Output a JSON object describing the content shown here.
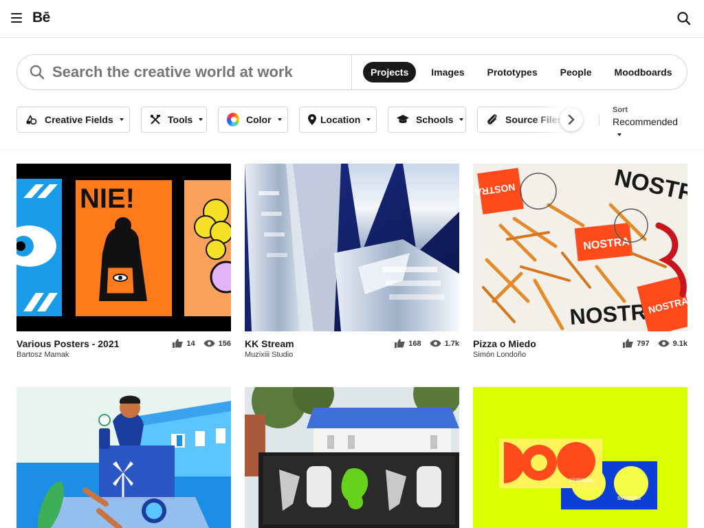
{
  "header": {
    "logo": "Bē"
  },
  "search": {
    "placeholder": "Search the creative world at work",
    "value": ""
  },
  "tabs": [
    {
      "label": "Projects",
      "active": true
    },
    {
      "label": "Images",
      "active": false
    },
    {
      "label": "Prototypes",
      "active": false
    },
    {
      "label": "People",
      "active": false
    },
    {
      "label": "Moodboards",
      "active": false
    }
  ],
  "filters": {
    "creative_fields": "Creative Fields",
    "tools": "Tools",
    "color": "Color",
    "location": "Location",
    "schools": "Schools",
    "source_files": "Source Files"
  },
  "sort": {
    "label": "Sort",
    "value": "Recommended"
  },
  "projects": [
    {
      "title": "Various Posters - 2021",
      "owner": "Bartosz Mamak",
      "likes": "14",
      "views": "156"
    },
    {
      "title": "KK Stream",
      "owner": "Muzixiii Studio",
      "likes": "168",
      "views": "1.7k"
    },
    {
      "title": "Pizza o Miedo",
      "owner": "Simón Londoño",
      "likes": "797",
      "views": "9.1k"
    },
    {
      "title": "",
      "owner": "",
      "likes": "",
      "views": ""
    },
    {
      "title": "",
      "owner": "",
      "likes": "",
      "views": ""
    },
    {
      "title": "",
      "owner": "",
      "likes": "",
      "views": ""
    }
  ],
  "artwork_text": {
    "poster_word": "NIE!",
    "brand_word": "NOSTRA",
    "sintropia": "sintropia"
  },
  "colors": {
    "accent_dark": "#191919",
    "lime": "#d9ff00",
    "poster_orange": "#ff7a1a",
    "poster_blue": "#1a9be8",
    "nostra_red": "#ff4a1c"
  }
}
